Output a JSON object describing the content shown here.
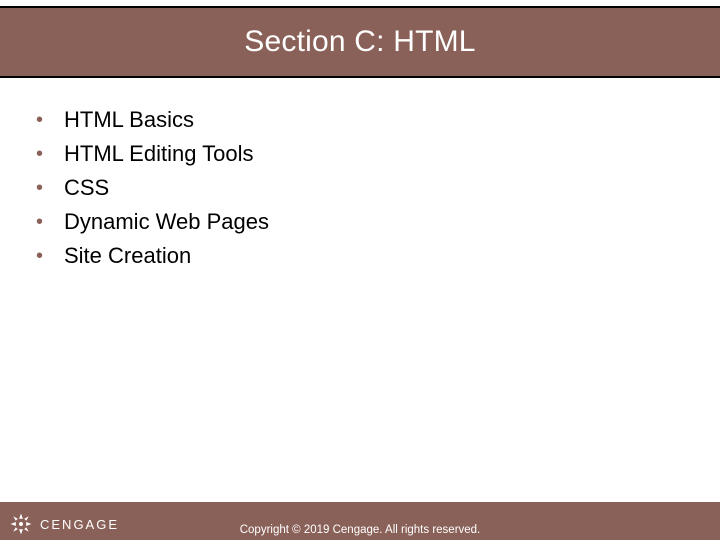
{
  "title": "Section C: HTML",
  "bullets": [
    {
      "text": "HTML Basics"
    },
    {
      "text": "HTML Editing Tools"
    },
    {
      "text": "CSS"
    },
    {
      "text": "Dynamic Web Pages"
    },
    {
      "text": "Site Creation"
    }
  ],
  "footer": {
    "brand": "CENGAGE",
    "copyright": "Copyright © 2019 Cengage. All rights reserved."
  }
}
